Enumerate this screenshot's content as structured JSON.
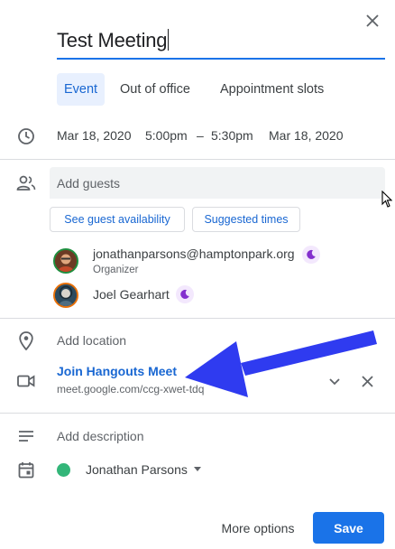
{
  "title": {
    "value": "Test Meeting"
  },
  "tabs": [
    {
      "label": "Event",
      "active": true
    },
    {
      "label": "Out of office",
      "active": false
    },
    {
      "label": "Appointment slots",
      "active": false
    }
  ],
  "datetime": {
    "start_date": "Mar 18, 2020",
    "start_time": "5:00pm",
    "separator": "–",
    "end_time": "5:30pm",
    "end_date": "Mar 18, 2020"
  },
  "guests": {
    "placeholder": "Add guests",
    "see_availability": "See guest availability",
    "suggested_times": "Suggested times",
    "list": [
      {
        "name": "jonathanparsons@hamptonpark.org",
        "role": "Organizer"
      },
      {
        "name": "Joel Gearhart",
        "role": ""
      }
    ]
  },
  "location": {
    "placeholder": "Add location"
  },
  "conference": {
    "label": "Join Hangouts Meet",
    "url": "meet.google.com/ccg-xwet-tdq"
  },
  "description": {
    "placeholder": "Add description"
  },
  "calendar": {
    "owner": "Jonathan Parsons",
    "color": "#33b679"
  },
  "footer": {
    "more_options": "More options",
    "save": "Save"
  },
  "colors": {
    "accent": "#1a73e8",
    "annotation_arrow": "#2f3bf0"
  },
  "icons": [
    "close-icon",
    "clock-icon",
    "people-icon",
    "location-pin-icon",
    "video-camera-icon",
    "chevron-down-icon",
    "notes-icon",
    "calendar-icon",
    "moon-icon"
  ]
}
